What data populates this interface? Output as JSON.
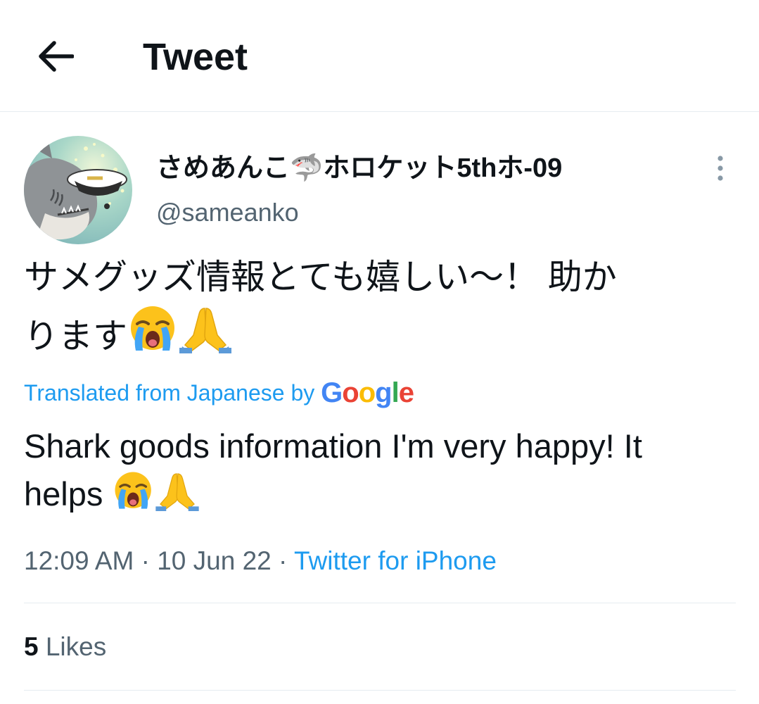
{
  "header": {
    "title": "Tweet"
  },
  "author": {
    "display_name": "さめあんこ🦈ホロケット5thホ-09",
    "handle": "@sameanko"
  },
  "tweet": {
    "text_line1": "サメグッズ情報とても嬉しい〜！ 助か",
    "text_line2": "ります",
    "translated_label": "Translated from Japanese by",
    "google_logo_text": "Google",
    "translation_line1": "Shark goods information I'm very happy! It",
    "translation_line2": "helps"
  },
  "meta": {
    "time": "12:09 AM",
    "separator": "·",
    "date": "10 Jun 22",
    "source": "Twitter for iPhone"
  },
  "stats": {
    "likes_count": "5",
    "likes_label": "Likes"
  },
  "icons": {
    "back": "arrow-left-icon",
    "more": "more-vertical-icon",
    "shark": "shark-emoji",
    "crying": "loudly-crying-face-emoji",
    "pray": "folded-hands-emoji"
  },
  "colors": {
    "text_primary": "#0f1419",
    "text_secondary": "#536471",
    "link": "#1d9bf0",
    "divider": "#e6ecf0",
    "google_blue": "#4285f4",
    "google_red": "#ea4335",
    "google_yellow": "#fbbc05",
    "google_green": "#34a853"
  }
}
